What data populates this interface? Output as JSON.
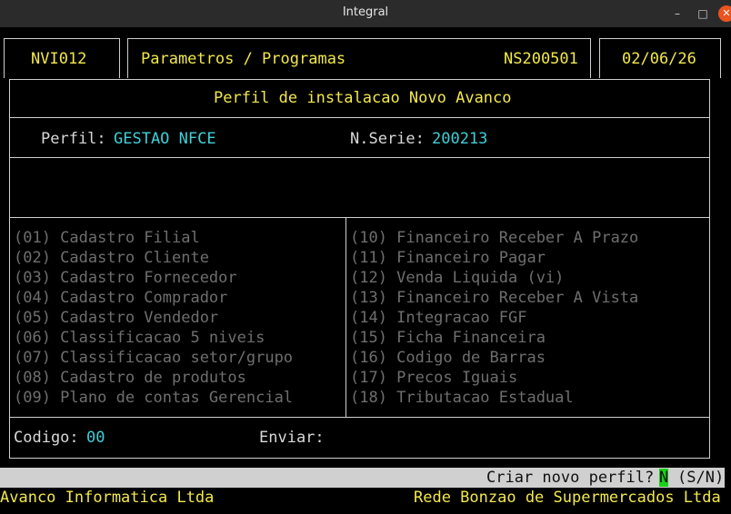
{
  "window": {
    "title": "Integral"
  },
  "header": {
    "program_code": "NVI012",
    "section": "Parametros / Programas",
    "serial_code": "NS200501",
    "date": "02/06/26"
  },
  "form": {
    "title": "Perfil de instalacao Novo Avanco",
    "perfil_label": "Perfil:",
    "perfil_value": "GESTAO NFCE",
    "serie_label": "N.Serie:",
    "serie_value": "200213"
  },
  "modules_left": [
    "(01) Cadastro Filial",
    "(02) Cadastro Cliente",
    "(03) Cadastro Fornecedor",
    "(04) Cadastro Comprador",
    "(05) Cadastro Vendedor",
    "(06) Classificacao 5 niveis",
    "(07) Classificacao setor/grupo",
    "(08) Cadastro de produtos",
    "(09) Plano de contas Gerencial"
  ],
  "modules_right": [
    "(10) Financeiro Receber A Prazo",
    "(11) Financeiro Pagar",
    "(12) Venda Liquida (vi)",
    "(13) Financeiro Receber A Vista",
    "(14) Integracao FGF",
    "(15) Ficha Financeira",
    "(16) Codigo de Barras",
    "(17) Precos Iguais",
    "(18) Tributacao Estadual"
  ],
  "footer_fields": {
    "codigo_label": "Codigo:",
    "codigo_value": "00",
    "enviar_label": "Enviar:"
  },
  "prompt": {
    "question": "Criar novo perfil?",
    "answer": "N",
    "options": "(S/N)"
  },
  "statusbar": {
    "left": "Avanco Informatica Ltda",
    "right": "Rede Bonzao de Supermercados Ltda"
  },
  "colors": {
    "highlight": "#f2e84a",
    "value": "#3fd0d8",
    "disabled": "#6e6e6e",
    "cursor": "#19d219"
  }
}
